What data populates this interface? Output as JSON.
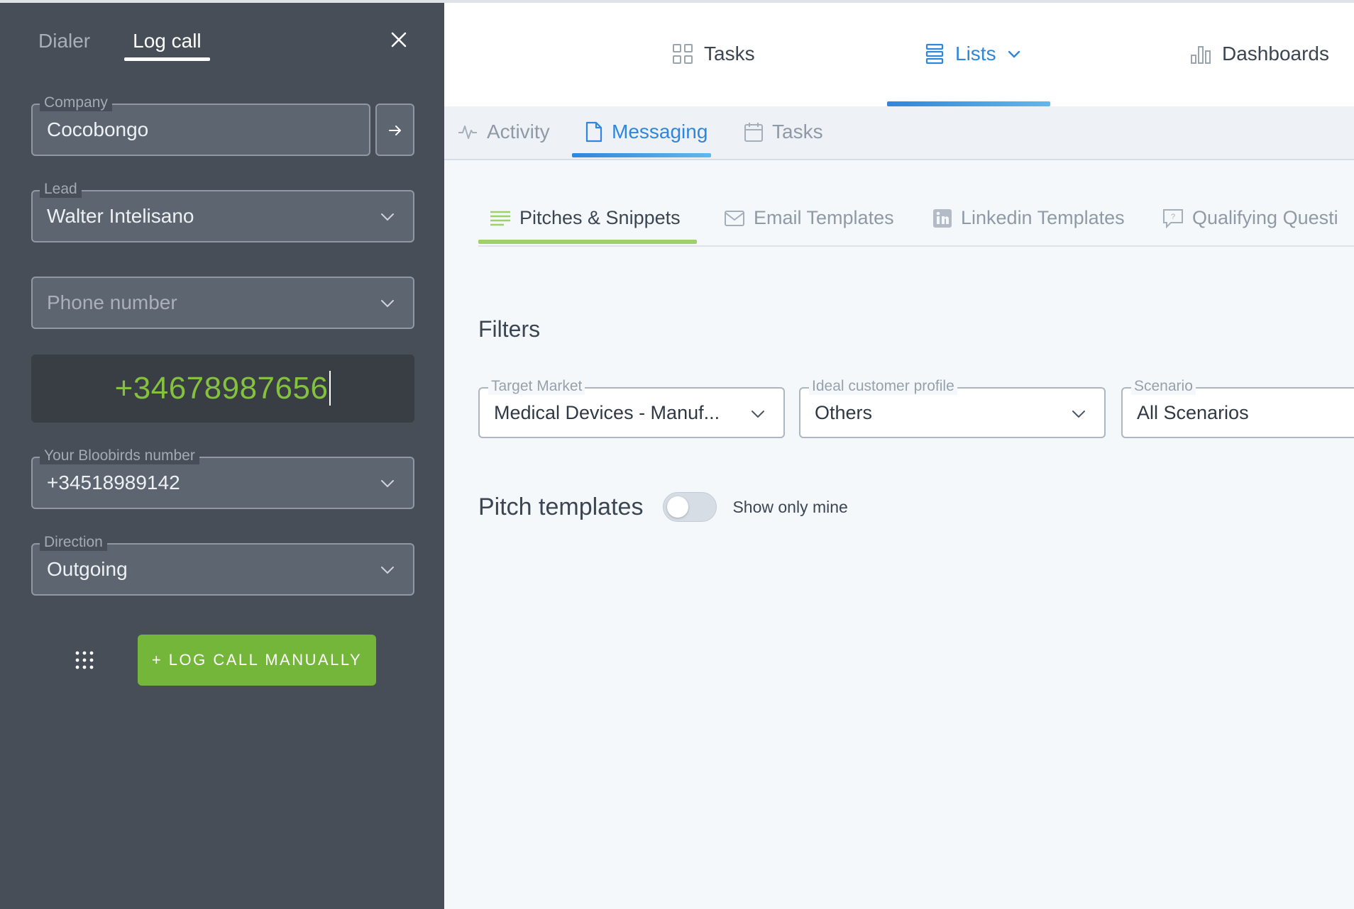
{
  "dialer": {
    "tabs": [
      {
        "label": "Dialer"
      },
      {
        "label": "Log call"
      }
    ],
    "active_tab": "Log call",
    "company": {
      "label": "Company",
      "value": "Cocobongo"
    },
    "lead": {
      "label": "Lead",
      "value": "Walter Intelisano"
    },
    "phone": {
      "placeholder": "Phone number"
    },
    "dialed_number": "+34678987656",
    "bloobirds_number": {
      "label": "Your Bloobirds number",
      "value": "+34518989142"
    },
    "direction": {
      "label": "Direction",
      "value": "Outgoing"
    },
    "log_button": "+  LOG CALL MANUALLY",
    "icons": {
      "close": "close-icon",
      "go": "arrow-right-icon",
      "keypad": "keypad-icon",
      "chevron": "chevron-down-icon"
    }
  },
  "topnav": {
    "items": [
      {
        "label": "Tasks",
        "icon": "grid-icon"
      },
      {
        "label": "Lists",
        "icon": "list-icon"
      },
      {
        "label": "Dashboards",
        "icon": "bar-chart-icon"
      }
    ],
    "active": "Lists"
  },
  "subnav": {
    "items": [
      {
        "label": "Activity",
        "icon": "activity-icon"
      },
      {
        "label": "Messaging",
        "icon": "document-icon"
      },
      {
        "label": "Tasks",
        "icon": "calendar-icon"
      }
    ],
    "active": "Messaging"
  },
  "messaging_tabs": {
    "items": [
      {
        "label": "Pitches & Snippets",
        "icon": "lines-icon"
      },
      {
        "label": "Email Templates",
        "icon": "mail-icon"
      },
      {
        "label": "Linkedin Templates",
        "icon": "linkedin-icon"
      },
      {
        "label": "Qualifying Questi",
        "icon": "question-icon"
      }
    ],
    "active": "Pitches & Snippets"
  },
  "filters": {
    "title": "Filters",
    "target_market": {
      "label": "Target Market",
      "value": "Medical Devices - Manuf..."
    },
    "icp": {
      "label": "Ideal customer profile",
      "value": "Others"
    },
    "scenario": {
      "label": "Scenario",
      "value": "All Scenarios"
    }
  },
  "pitch_templates": {
    "title": "Pitch templates",
    "toggle_label": "Show only mine",
    "toggle_on": false
  },
  "colors": {
    "dialer_bg": "#474e57",
    "accent_blue": "#2f86dd",
    "accent_green": "#74b63a",
    "number_green": "#84c13e",
    "pitch_underline": "#9ed16a"
  }
}
